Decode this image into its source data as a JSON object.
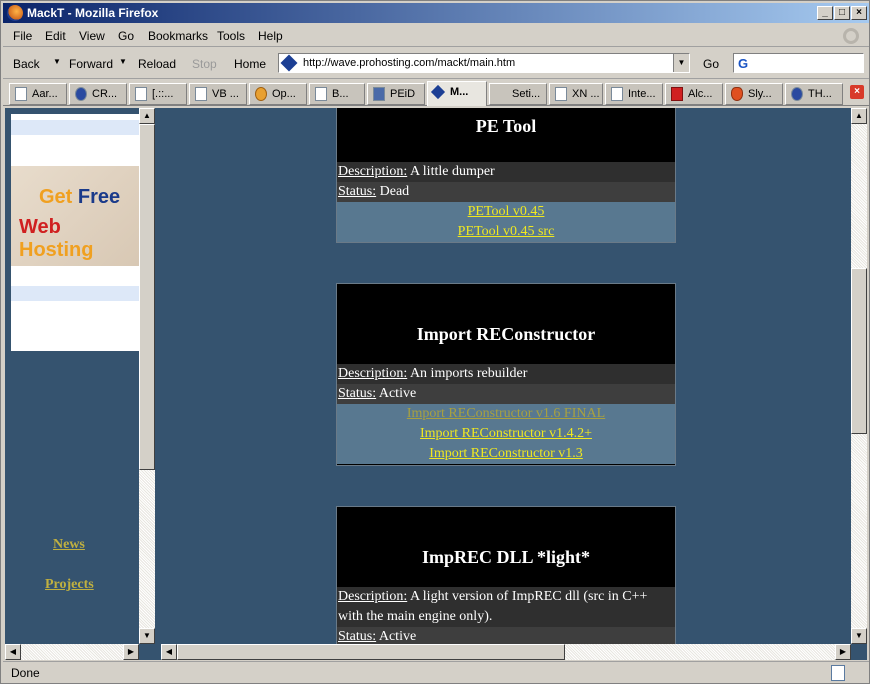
{
  "window": {
    "title": "MackT - Mozilla Firefox"
  },
  "menu": [
    "File",
    "Edit",
    "View",
    "Go",
    "Bookmarks",
    "Tools",
    "Help"
  ],
  "nav": {
    "back": "Back",
    "forward": "Forward",
    "reload": "Reload",
    "stop": "Stop",
    "home": "Home",
    "url": "http://wave.prohosting.com/mackt/main.htm",
    "go": "Go"
  },
  "tabs": [
    {
      "label": "Aar...",
      "icon": "page-icon"
    },
    {
      "label": "CR...",
      "icon": "globe-icon"
    },
    {
      "label": "[.::...",
      "icon": "page-icon"
    },
    {
      "label": "VB ...",
      "icon": "page-icon"
    },
    {
      "label": "Op...",
      "icon": "gear-icon"
    },
    {
      "label": "B...",
      "icon": "page-icon"
    },
    {
      "label": "PEiD",
      "icon": "app-icon"
    },
    {
      "label": "M...",
      "icon": "diamond-icon",
      "active": true
    },
    {
      "label": "Seti...",
      "icon": "cursor-icon"
    },
    {
      "label": "XN ...",
      "icon": "page-icon"
    },
    {
      "label": "Inte...",
      "icon": "page-icon"
    },
    {
      "label": "Alc...",
      "icon": "alcohol-icon"
    },
    {
      "label": "Sly...",
      "icon": "fox-icon"
    },
    {
      "label": "TH...",
      "icon": "bolt-icon"
    }
  ],
  "sidebar": {
    "ad": {
      "line1a": "Get",
      "line1b": "Free",
      "line2a": "Web",
      "line2b": "Hosting"
    },
    "links": {
      "news": "News",
      "projects": "Projects"
    }
  },
  "cards": [
    {
      "title": "PE Tool",
      "description_label": "Description:",
      "description": " A little dumper",
      "status_label": "Status:",
      "status": " Dead",
      "links": [
        {
          "text": "PETool v0.45"
        },
        {
          "text": "PETool v0.45 src"
        }
      ]
    },
    {
      "title": "Import REConstructor",
      "description_label": "Description:",
      "description": " An imports rebuilder",
      "status_label": "Status:",
      "status": " Active",
      "links": [
        {
          "text": "Import REConstructor v1.6 FINAL",
          "visited": true
        },
        {
          "text": "Import REConstructor v1.4.2+"
        },
        {
          "text": "Import REConstructor v1.3"
        }
      ]
    },
    {
      "title": "ImpREC DLL *light*",
      "description_label": "Description:",
      "description": " A light version of ImpREC dll (src in C++ with the main engine only).",
      "status_label": "Status:",
      "status": " Active"
    }
  ],
  "status": {
    "text": "Done"
  }
}
